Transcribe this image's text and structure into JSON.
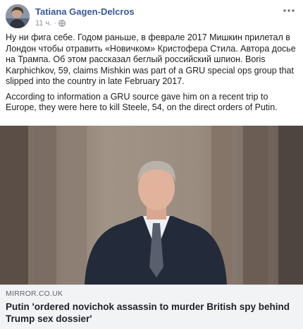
{
  "post": {
    "author": "Tatiana Gagen-Delcros",
    "timestamp": "11 ч.",
    "privacy_icon": "globe-icon",
    "more_icon": "more-dots-icon",
    "paragraphs": [
      "Ну ни фига себе. Годом раньше, в феврале 2017 Мишкин прилетал в Лондон чтобы отравить «Новичком» Кристофера Стила. Автора досье на Трампа. Об этом рассказал беглый российский шпион. Boris Karphichkov, 59, claims Mishkin was part of a GRU special ops group that slipped into the country in late February 2017.",
      "According to information a GRU source gave him on a recent trip to Europe, they were here to kill Steele, 54, on the direct orders of Putin."
    ]
  },
  "link": {
    "domain": "MIRROR.CO.UK",
    "headline": "Putin 'ordered novichok assassin to murder British spy behind Trump sex dossier'"
  },
  "colors": {
    "author": "#385898",
    "caption_bg": "#f2f3f5",
    "meta": "#90949c"
  }
}
